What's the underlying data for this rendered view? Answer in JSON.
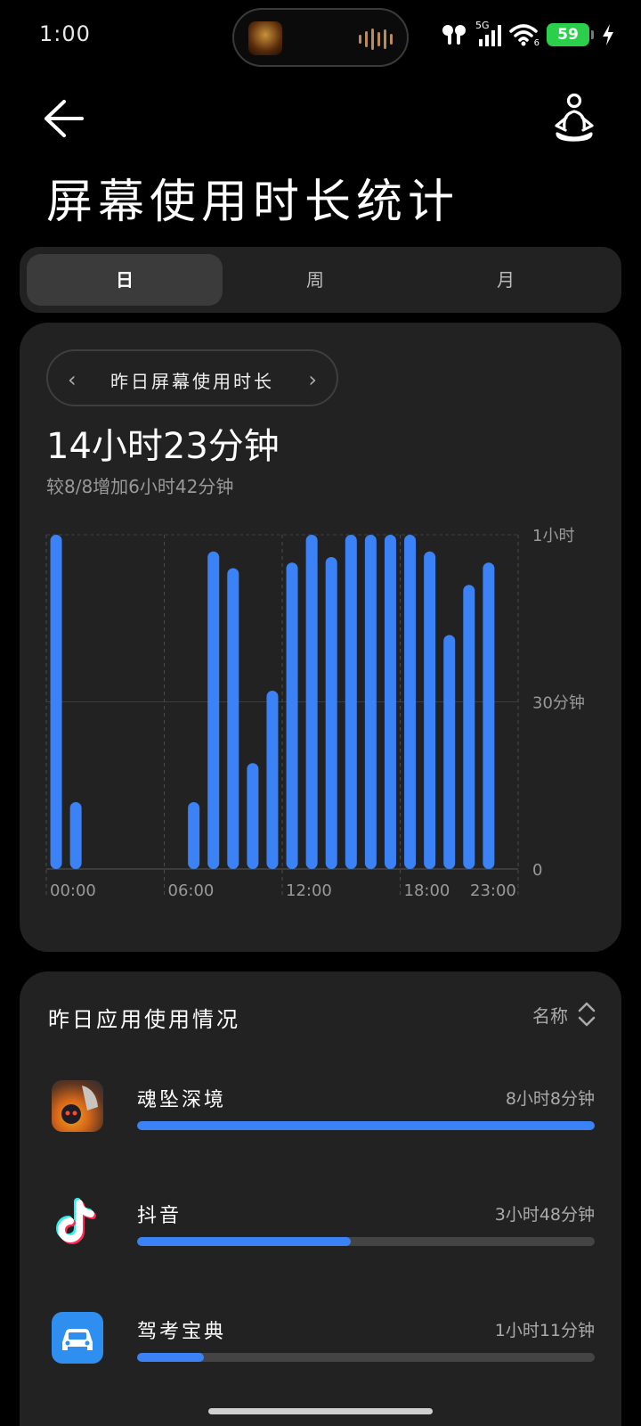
{
  "status_bar": {
    "time": "1:00",
    "network": "5G",
    "wifi_level": "6",
    "battery": "59"
  },
  "header": {
    "title": "屏幕使用时长统计"
  },
  "tabs": [
    {
      "label": "日",
      "active": true
    },
    {
      "label": "周",
      "active": false
    },
    {
      "label": "月",
      "active": false
    }
  ],
  "summary": {
    "range_label": "昨日屏幕使用时长",
    "total": "14小时23分钟",
    "compare": "较8/8增加6小时42分钟"
  },
  "chart_data": {
    "type": "bar",
    "title": "",
    "xlabel": "",
    "ylabel": "",
    "y_unit": "minutes",
    "ylim": [
      0,
      60
    ],
    "y_ticks": [
      {
        "value": 60,
        "label": "1小时"
      },
      {
        "value": 30,
        "label": "30分钟"
      },
      {
        "value": 0,
        "label": "0"
      }
    ],
    "x_tick_labels": [
      {
        "hour": 0,
        "label": "00:00"
      },
      {
        "hour": 6,
        "label": "06:00"
      },
      {
        "hour": 12,
        "label": "12:00"
      },
      {
        "hour": 18,
        "label": "18:00"
      },
      {
        "hour": 23,
        "label": "23:00"
      }
    ],
    "categories": [
      "0",
      "1",
      "2",
      "3",
      "4",
      "5",
      "6",
      "7",
      "8",
      "9",
      "10",
      "11",
      "12",
      "13",
      "14",
      "15",
      "16",
      "17",
      "18",
      "19",
      "20",
      "21",
      "22",
      "23"
    ],
    "values": [
      60,
      12,
      0,
      0,
      0,
      0,
      0,
      12,
      57,
      54,
      19,
      32,
      55,
      60,
      56,
      60,
      60,
      60,
      60,
      57,
      42,
      51,
      55
    ],
    "color": "#3a82f6",
    "grid": true
  },
  "apps": {
    "title": "昨日应用使用情况",
    "sort_label": "名称",
    "items": [
      {
        "name": "魂坠深境",
        "time": "8小时8分钟",
        "fraction": 1.0
      },
      {
        "name": "抖音",
        "time": "3小时48分钟",
        "fraction": 0.467
      },
      {
        "name": "驾考宝典",
        "time": "1小时11分钟",
        "fraction": 0.146
      }
    ]
  },
  "colors": {
    "accent": "#3a82f6",
    "card": "#222222",
    "background": "#000000"
  }
}
